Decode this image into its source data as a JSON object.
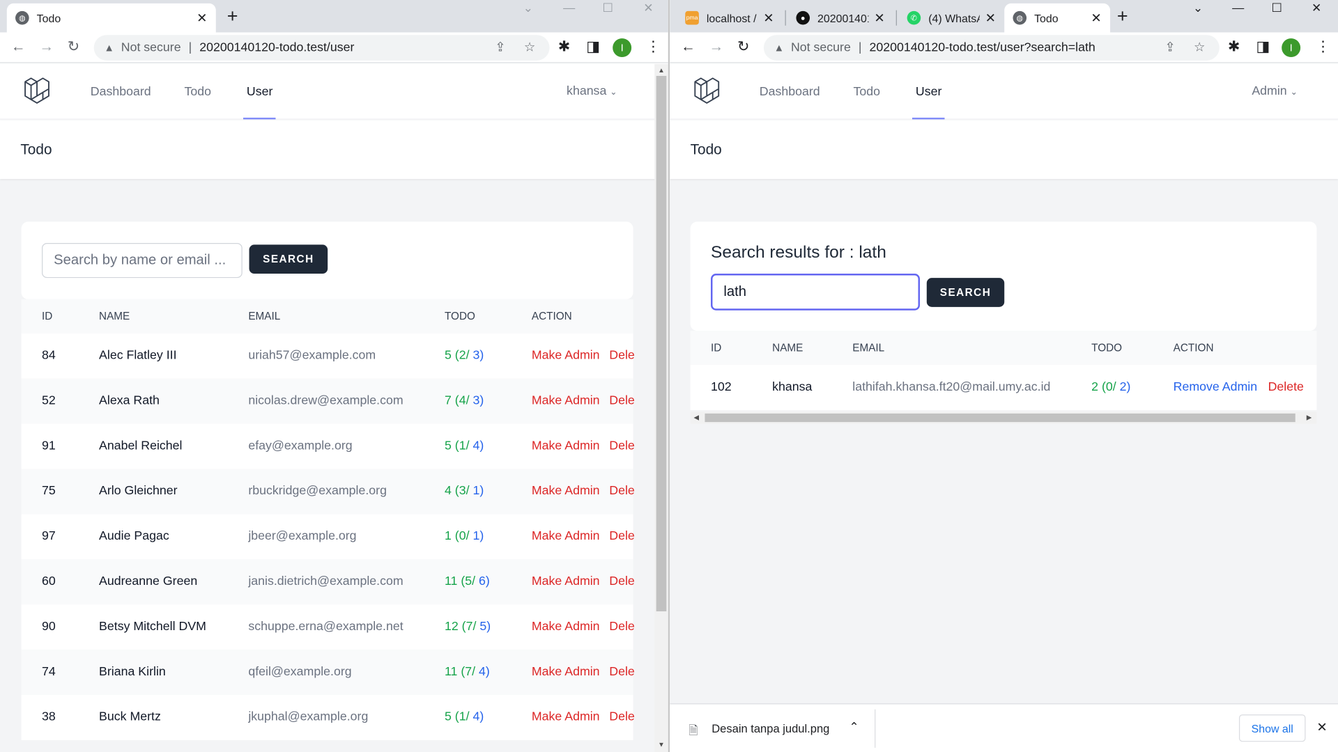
{
  "left": {
    "tabs": [
      {
        "label": "Todo"
      }
    ],
    "address": {
      "security": "Not secure",
      "url": "20200140120-todo.test/user"
    },
    "profile_initial": "I",
    "nav": {
      "links": [
        "Dashboard",
        "Todo",
        "User"
      ],
      "user": "khansa"
    },
    "header_title": "Todo",
    "search": {
      "placeholder": "Search by name or email ...",
      "button": "SEARCH"
    },
    "table": {
      "headers": [
        "ID",
        "NAME",
        "EMAIL",
        "TODO",
        "ACTION"
      ],
      "rows": [
        {
          "id": "84",
          "name": "Alec Flatley III",
          "email": "uriah57@example.com",
          "todo_total": "5",
          "todo_done": "(2/",
          "todo_open": " 3)",
          "action1": "Make Admin",
          "action2": "Dele"
        },
        {
          "id": "52",
          "name": "Alexa Rath",
          "email": "nicolas.drew@example.com",
          "todo_total": "7",
          "todo_done": "(4/",
          "todo_open": " 3)",
          "action1": "Make Admin",
          "action2": "Dele"
        },
        {
          "id": "91",
          "name": "Anabel Reichel",
          "email": "efay@example.org",
          "todo_total": "5",
          "todo_done": "(1/",
          "todo_open": " 4)",
          "action1": "Make Admin",
          "action2": "Dele"
        },
        {
          "id": "75",
          "name": "Arlo Gleichner",
          "email": "rbuckridge@example.org",
          "todo_total": "4",
          "todo_done": "(3/",
          "todo_open": " 1)",
          "action1": "Make Admin",
          "action2": "Dele"
        },
        {
          "id": "97",
          "name": "Audie Pagac",
          "email": "jbeer@example.org",
          "todo_total": "1",
          "todo_done": "(0/",
          "todo_open": " 1)",
          "action1": "Make Admin",
          "action2": "Dele"
        },
        {
          "id": "60",
          "name": "Audreanne Green",
          "email": "janis.dietrich@example.com",
          "todo_total": "11",
          "todo_done": "(5/",
          "todo_open": " 6)",
          "action1": "Make Admin",
          "action2": "Dele"
        },
        {
          "id": "90",
          "name": "Betsy Mitchell DVM",
          "email": "schuppe.erna@example.net",
          "todo_total": "12",
          "todo_done": "(7/",
          "todo_open": " 5)",
          "action1": "Make Admin",
          "action2": "Dele"
        },
        {
          "id": "74",
          "name": "Briana Kirlin",
          "email": "qfeil@example.org",
          "todo_total": "11",
          "todo_done": "(7/",
          "todo_open": " 4)",
          "action1": "Make Admin",
          "action2": "Dele"
        },
        {
          "id": "38",
          "name": "Buck Mertz",
          "email": "jkuphal@example.org",
          "todo_total": "5",
          "todo_done": "(1/",
          "todo_open": " 4)",
          "action1": "Make Admin",
          "action2": "Dele"
        }
      ]
    }
  },
  "right": {
    "tabs": [
      {
        "label": "localhost /"
      },
      {
        "label": "202001401"
      },
      {
        "label": "(4) WhatsA"
      },
      {
        "label": "Todo"
      }
    ],
    "address": {
      "security": "Not secure",
      "url": "20200140120-todo.test/user?search=lath"
    },
    "profile_initial": "I",
    "nav": {
      "links": [
        "Dashboard",
        "Todo",
        "User"
      ],
      "user": "Admin"
    },
    "header_title": "Todo",
    "search": {
      "heading": "Search results for : lath",
      "value": "lath",
      "button": "SEARCH"
    },
    "table": {
      "headers": [
        "ID",
        "NAME",
        "EMAIL",
        "TODO",
        "ACTION"
      ],
      "rows": [
        {
          "id": "102",
          "name": "khansa",
          "email": "lathifah.khansa.ft20@mail.umy.ac.id",
          "todo_total": "2",
          "todo_done": "(0/",
          "todo_open": " 2)",
          "action1": "Remove Admin",
          "action2": "Delete"
        }
      ]
    },
    "download": {
      "filename": "Desain tanpa judul.png",
      "show_all": "Show all"
    }
  },
  "colors": {
    "accent": "#818cf8",
    "danger": "#dc2626",
    "link": "#2563eb",
    "success": "#16a34a",
    "button": "#1f2937"
  }
}
